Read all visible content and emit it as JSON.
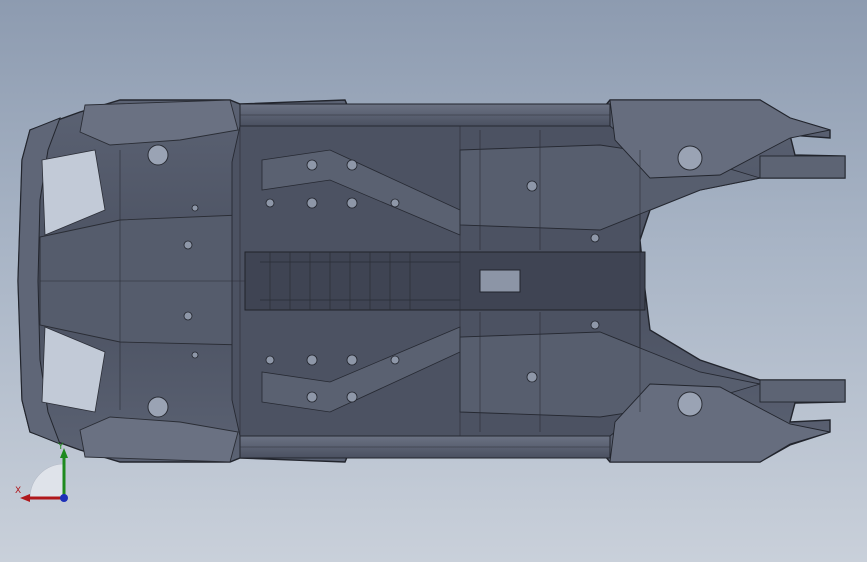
{
  "viewport": {
    "background_top": "#8d9bb0",
    "background_bottom": "#c9d0da"
  },
  "model": {
    "icon": "car-underbody-chassis",
    "base_color": "#4e5566",
    "edge_color": "#23262e"
  },
  "triad": {
    "x_label": "X",
    "y_label": "Y",
    "x_color": "#b0181c",
    "y_color": "#1e8a1e",
    "z_color": "#1c2fb8"
  }
}
